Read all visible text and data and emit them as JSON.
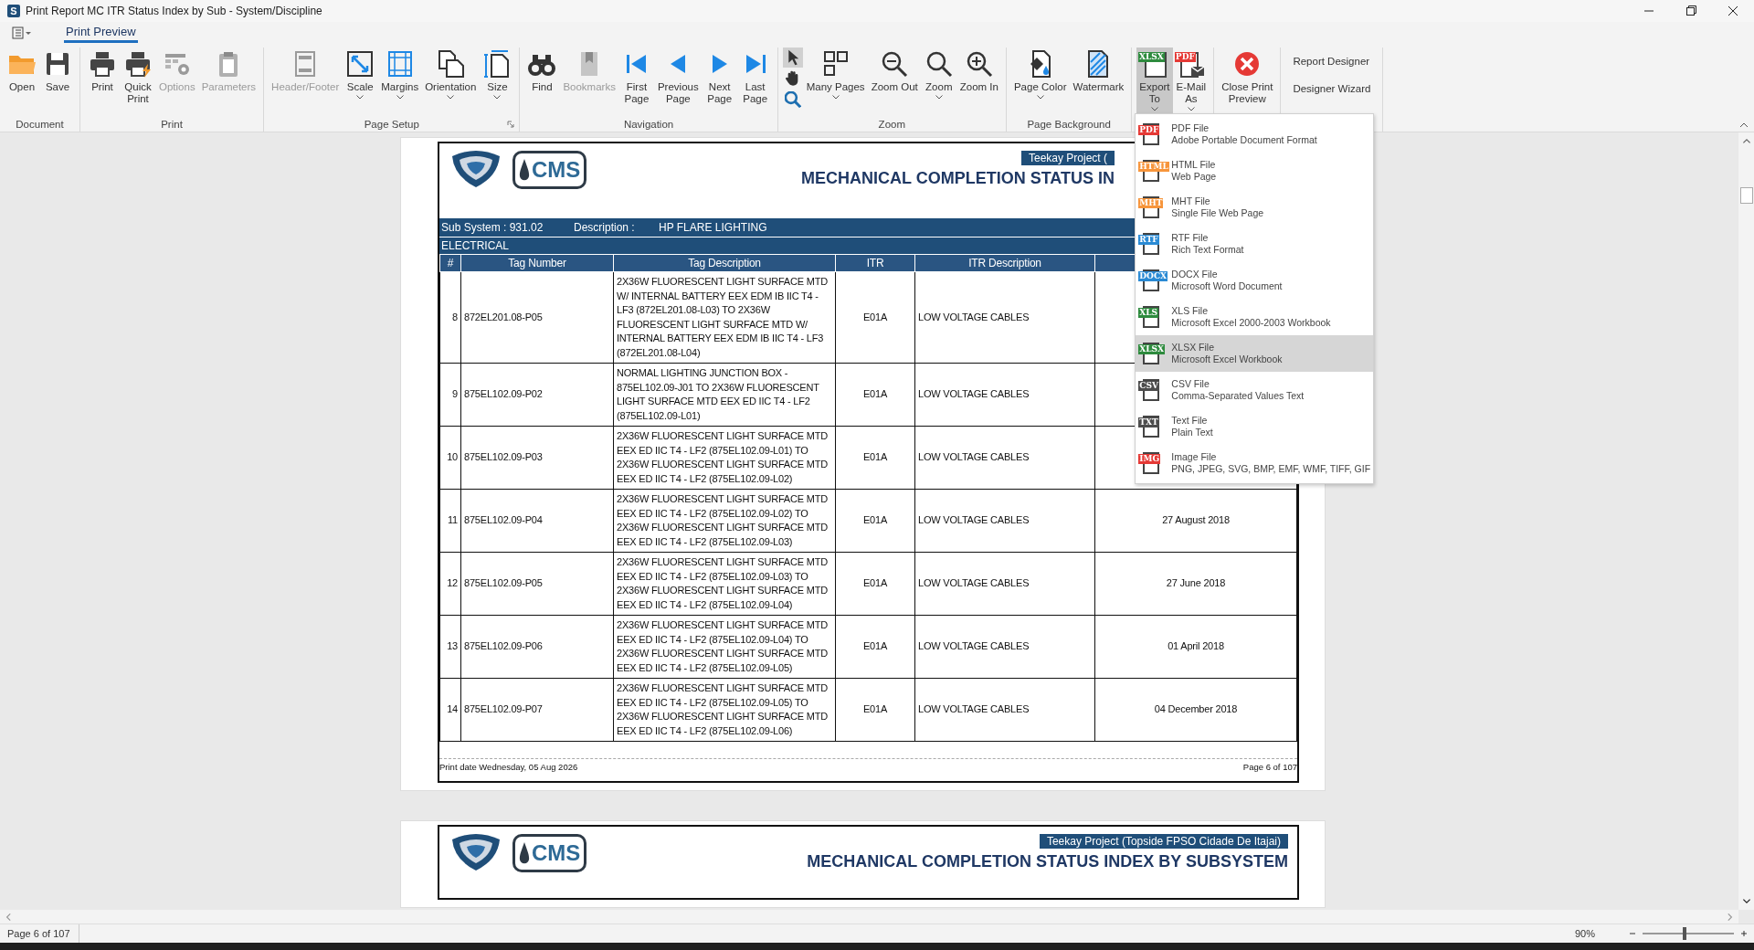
{
  "window": {
    "title": "Print Report MC ITR Status Index by Sub - System/Discipline",
    "app_icon_letter": "S"
  },
  "tabs": [
    {
      "label": "Print Preview",
      "selected": true
    }
  ],
  "ribbon": {
    "groups": [
      {
        "label": "Document",
        "items": [
          {
            "kind": "large",
            "label": "Open",
            "disabled": false,
            "dropdown": false,
            "pressed": false
          },
          {
            "kind": "large",
            "label": "Save",
            "disabled": false,
            "dropdown": false,
            "pressed": false
          }
        ]
      },
      {
        "label": "Print",
        "items": [
          {
            "kind": "large",
            "label": "Print",
            "disabled": false,
            "dropdown": false,
            "pressed": false
          },
          {
            "kind": "large",
            "label": "Quick\nPrint",
            "disabled": false,
            "dropdown": false,
            "pressed": false
          },
          {
            "kind": "large",
            "label": "Options",
            "disabled": true,
            "dropdown": false,
            "pressed": false
          },
          {
            "kind": "large",
            "label": "Parameters",
            "disabled": true,
            "dropdown": false,
            "pressed": false
          }
        ]
      },
      {
        "label": "Page Setup",
        "launcher": true,
        "items": [
          {
            "kind": "large",
            "label": "Header/Footer",
            "disabled": true,
            "dropdown": false,
            "pressed": false
          },
          {
            "kind": "large",
            "label": "Scale",
            "disabled": false,
            "dropdown": true,
            "pressed": false
          },
          {
            "kind": "large",
            "label": "Margins",
            "disabled": false,
            "dropdown": true,
            "pressed": false
          },
          {
            "kind": "large",
            "label": "Orientation",
            "disabled": false,
            "dropdown": true,
            "pressed": false
          },
          {
            "kind": "large",
            "label": "Size",
            "disabled": false,
            "dropdown": true,
            "pressed": false
          }
        ]
      },
      {
        "label": "Navigation",
        "items": [
          {
            "kind": "large",
            "label": "Find",
            "disabled": false,
            "dropdown": false,
            "pressed": false
          },
          {
            "kind": "large",
            "label": "Bookmarks",
            "disabled": true,
            "dropdown": false,
            "pressed": false
          },
          {
            "kind": "large",
            "label": "First\nPage",
            "disabled": false,
            "dropdown": false,
            "pressed": false
          },
          {
            "kind": "large",
            "label": "Previous\nPage",
            "disabled": false,
            "dropdown": false,
            "pressed": false
          },
          {
            "kind": "large",
            "label": "Next\nPage",
            "disabled": false,
            "dropdown": false,
            "pressed": false
          },
          {
            "kind": "large",
            "label": "Last\nPage",
            "disabled": false,
            "dropdown": false,
            "pressed": false
          }
        ]
      },
      {
        "label": "Zoom",
        "items": [
          {
            "kind": "tools",
            "tools": [
              {
                "selected": true
              },
              {
                "selected": false
              },
              {
                "selected": false
              }
            ]
          },
          {
            "kind": "large",
            "label": "Many Pages",
            "disabled": false,
            "dropdown": true,
            "pressed": false
          },
          {
            "kind": "large",
            "label": "Zoom Out",
            "disabled": false,
            "dropdown": false,
            "pressed": false
          },
          {
            "kind": "large",
            "label": "Zoom",
            "disabled": false,
            "dropdown": true,
            "pressed": false
          },
          {
            "kind": "large",
            "label": "Zoom In",
            "disabled": false,
            "dropdown": false,
            "pressed": false
          }
        ]
      },
      {
        "label": "Page Background",
        "items": [
          {
            "kind": "large",
            "label": "Page Color",
            "disabled": false,
            "dropdown": true,
            "pressed": false
          },
          {
            "kind": "large",
            "label": "Watermark",
            "disabled": false,
            "dropdown": false,
            "pressed": false
          }
        ]
      },
      {
        "items": [
          {
            "kind": "large",
            "badge": "XLSX",
            "label": "Export\nTo",
            "disabled": false,
            "dropdown": true,
            "pressed": true
          },
          {
            "kind": "large",
            "badge": "PDF",
            "label": "E-Mail\nAs",
            "disabled": false,
            "dropdown": true,
            "pressed": false
          }
        ]
      },
      {
        "items": [
          {
            "kind": "large",
            "label": "Close Print\nPreview",
            "disabled": false,
            "dropdown": false,
            "pressed": false
          }
        ]
      },
      {
        "items": [
          {
            "kind": "small",
            "label": "Report Designer"
          },
          {
            "kind": "small",
            "label": "Designer Wizard"
          }
        ]
      }
    ]
  },
  "export_menu": [
    {
      "badge": "PDF",
      "color": "#e53935",
      "title": "PDF File",
      "subtitle": "Adobe Portable Document Format",
      "selected": false
    },
    {
      "badge": "HTML",
      "color": "#f7953b",
      "title": "HTML File",
      "subtitle": "Web Page",
      "selected": false
    },
    {
      "badge": "MHT",
      "color": "#f7953b",
      "title": "MHT File",
      "subtitle": "Single File Web Page",
      "selected": false
    },
    {
      "badge": "RTF",
      "color": "#2a8ad4",
      "title": "RTF File",
      "subtitle": "Rich Text Format",
      "selected": false
    },
    {
      "badge": "DOCX",
      "color": "#2a8ad4",
      "title": "DOCX File",
      "subtitle": "Microsoft Word Document",
      "selected": false
    },
    {
      "badge": "XLS",
      "color": "#2e8b3e",
      "title": "XLS File",
      "subtitle": "Microsoft Excel 2000-2003 Workbook",
      "selected": false
    },
    {
      "badge": "XLSX",
      "color": "#2e8b3e",
      "title": "XLSX File",
      "subtitle": "Microsoft Excel Workbook",
      "selected": true
    },
    {
      "badge": "CSV",
      "color": "#4d4d4d",
      "title": "CSV File",
      "subtitle": "Comma-Separated Values Text",
      "selected": false
    },
    {
      "badge": "TXT",
      "color": "#4d4d4d",
      "title": "Text File",
      "subtitle": "Plain Text",
      "selected": false
    },
    {
      "badge": "IMG",
      "color": "#e53935",
      "title": "Image File",
      "subtitle": "PNG, JPEG, SVG, BMP, EMF, WMF, TIFF, GIF",
      "selected": false
    }
  ],
  "pages": [
    {
      "logo_text": "CMS",
      "project": "Teekay Project (",
      "title": "MECHANICAL COMPLETION STATUS IN",
      "section": {
        "sub_system": "Sub System : 931.02",
        "description_label": "Description :",
        "description": "HP FLARE LIGHTING",
        "discipline": "ELECTRICAL"
      },
      "columns": [
        "#",
        "Tag Number",
        "Tag Description",
        "ITR",
        "ITR Description"
      ],
      "rows": [
        {
          "num": "8",
          "tag": "872EL201.08-P05",
          "description": "2X36W FLUORESCENT LIGHT SURFACE MTD W/ INTERNAL BATTERY EEX EDM IB IIC T4 - LF3 (872EL201.08-L03) TO 2X36W FLUORESCENT LIGHT SURFACE MTD  W/ INTERNAL BATTERY EEX EDM IB IIC T4 - LF3 (872EL201.08-L04)",
          "itr": "E01A",
          "itr_description": "LOW VOLTAGE CABLES"
        },
        {
          "num": "9",
          "tag": "875EL102.09-P02",
          "description": "NORMAL LIGHTING JUNCTION BOX - 875EL102.09-J01 TO 2X36W FLUORESCENT LIGHT SURFACE MTD EEX ED IIC T4 - LF2 (875EL102.09-L01)",
          "itr": "E01A",
          "itr_description": "LOW VOLTAGE CABLES"
        },
        {
          "num": "10",
          "tag": "875EL102.09-P03",
          "description": "2X36W FLUORESCENT LIGHT SURFACE MTD EEX ED IIC T4 - LF2 (875EL102.09-L01) TO 2X36W FLUORESCENT LIGHT SURFACE MTD EEX ED IIC T4 - LF2 (875EL102.09-L02)",
          "itr": "E01A",
          "itr_description": "LOW VOLTAGE CABLES"
        },
        {
          "num": "11",
          "tag": "875EL102.09-P04",
          "description": "2X36W FLUORESCENT LIGHT SURFACE MTD EEX ED IIC T4 - LF2 (875EL102.09-L02) TO 2X36W FLUORESCENT LIGHT SURFACE MTD EEX ED IIC T4 - LF2 (875EL102.09-L03)",
          "itr": "E01A",
          "itr_description": "LOW VOLTAGE CABLES",
          "date": "27 August 2018"
        },
        {
          "num": "12",
          "tag": "875EL102.09-P05",
          "description": "2X36W FLUORESCENT LIGHT SURFACE MTD EEX ED IIC T4 - LF2 (875EL102.09-L03) TO 2X36W FLUORESCENT LIGHT SURFACE MTD EEX ED IIC T4 - LF2 (875EL102.09-L04)",
          "itr": "E01A",
          "itr_description": "LOW VOLTAGE CABLES",
          "date": "27 June 2018"
        },
        {
          "num": "13",
          "tag": "875EL102.09-P06",
          "description": "2X36W FLUORESCENT LIGHT SURFACE MTD EEX ED IIC T4 - LF2 (875EL102.09-L04) TO 2X36W FLUORESCENT LIGHT SURFACE MTD EEX ED IIC T4 - LF2 (875EL102.09-L05)",
          "itr": "E01A",
          "itr_description": "LOW VOLTAGE CABLES",
          "date": "01 April 2018"
        },
        {
          "num": "14",
          "tag": "875EL102.09-P07",
          "description": "2X36W FLUORESCENT LIGHT SURFACE MTD EEX ED IIC T4 - LF2 (875EL102.09-L05) TO 2X36W FLUORESCENT LIGHT SURFACE MTD EEX ED IIC T4 - LF2 (875EL102.09-L06)",
          "itr": "E01A",
          "itr_description": "LOW VOLTAGE CABLES",
          "date": "04 December 2018"
        }
      ],
      "print_date": "Print date Wednesday, 05 Aug 2026",
      "page_number": "Page 6 of 107"
    },
    {
      "logo_text": "CMS",
      "project": "Teekay Project (Topside FPSO Cidade De Itajai)",
      "title": "MECHANICAL COMPLETION STATUS INDEX BY SUBSYSTEM"
    }
  ],
  "status_bar": {
    "page": "Page 6 of 107",
    "zoom": "90%",
    "zoom_slider": {
      "level": 0.46
    }
  }
}
